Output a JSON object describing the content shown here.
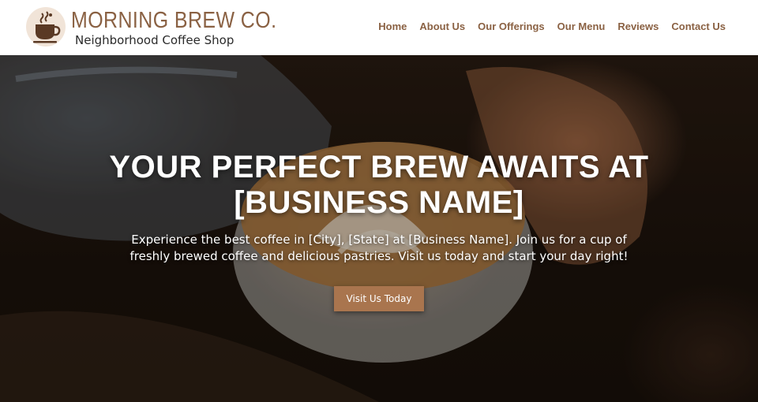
{
  "brand": {
    "name": "MORNING BREW CO.",
    "tagline": "Neighborhood Coffee Shop",
    "logo_icon": "coffee-cup-icon"
  },
  "nav": {
    "items": [
      {
        "label": "Home"
      },
      {
        "label": "About Us"
      },
      {
        "label": "Our Offerings"
      },
      {
        "label": "Our Menu"
      },
      {
        "label": "Reviews"
      },
      {
        "label": "Contact Us"
      }
    ]
  },
  "hero": {
    "title": "YOUR PERFECT BREW AWAITS AT [BUSINESS NAME]",
    "text": "Experience the best coffee in [City], [State] at [Business Name]. Join us for a cup of freshly brewed coffee and delicious pastries. Visit us today and start your day right!",
    "button_label": "Visit Us Today"
  },
  "colors": {
    "accent": "#8a6143",
    "button": "#a9754e",
    "header_bg": "#ffffff"
  }
}
